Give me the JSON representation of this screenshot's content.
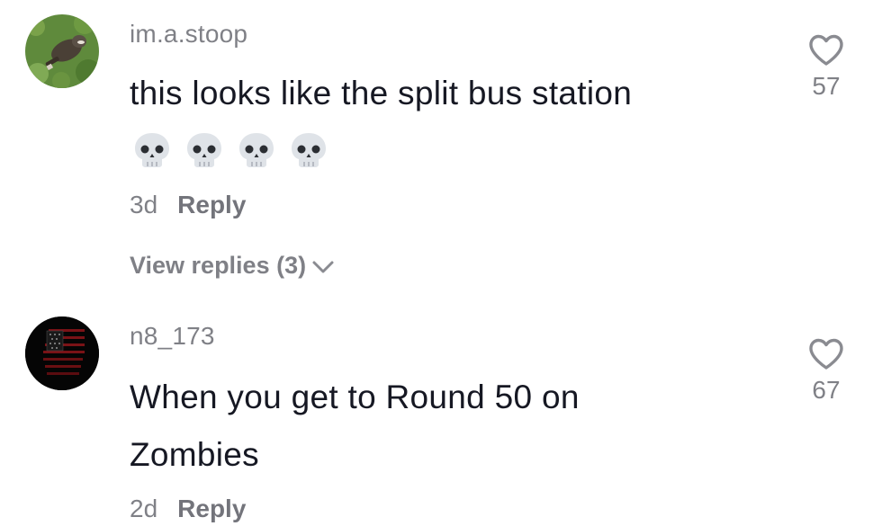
{
  "comments": [
    {
      "username": "im.a.stoop",
      "text": "this looks like the split bus station",
      "emojis": [
        "💀",
        "💀",
        "💀",
        "💀"
      ],
      "age": "3d",
      "reply_label": "Reply",
      "view_replies_label": "View replies (3)",
      "likes": "57"
    },
    {
      "username": "n8_173",
      "text_line1": "When you get to Round 50 on",
      "text_line2": "Zombies",
      "age": "2d",
      "reply_label": "Reply",
      "likes": "67"
    }
  ],
  "colors": {
    "primary_text": "#161823",
    "secondary_text": "#8a8b91",
    "heart_outline": "#8a8b91"
  },
  "icons": {
    "like": "heart-outline-icon",
    "expand": "chevron-down-icon",
    "emoji": "skull-icon"
  }
}
